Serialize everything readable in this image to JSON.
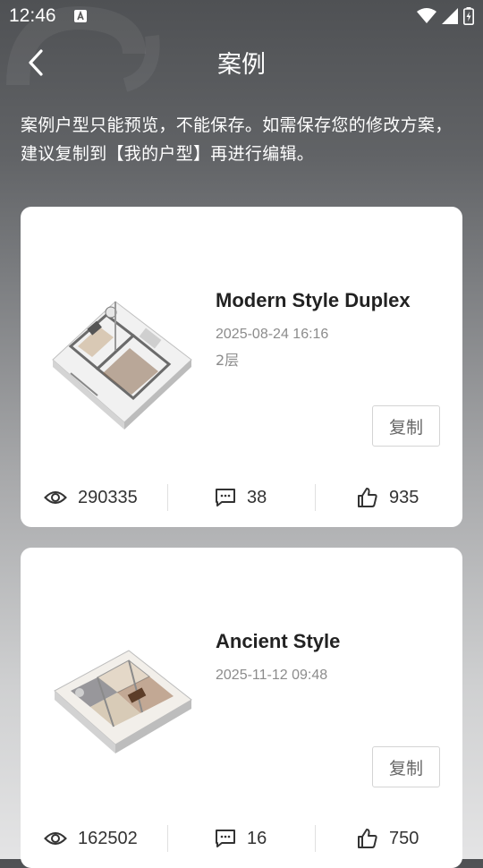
{
  "status": {
    "time": "12:46"
  },
  "header": {
    "title": "案例"
  },
  "notice": "案例户型只能预览，不能保存。如需保存您的修改方案，建议复制到【我的户型】再进行编辑。",
  "cases": [
    {
      "title": "Modern Style Duplex",
      "date": "2025-08-24 16:16",
      "floors": "2层",
      "copy_label": "复制",
      "views": "290335",
      "comments": "38",
      "likes": "935"
    },
    {
      "title": "Ancient Style",
      "date": "2025-11-12 09:48",
      "copy_label": "复制",
      "views": "162502",
      "comments": "16",
      "likes": "750"
    }
  ],
  "colors": {
    "card_bg": "#ffffff",
    "title_text": "#222222",
    "meta_text": "#8c8c8c"
  }
}
